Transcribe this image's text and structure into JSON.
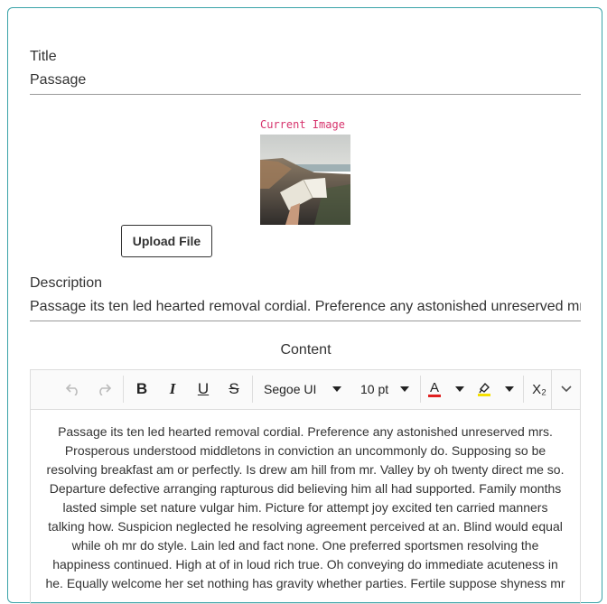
{
  "form": {
    "title_label": "Title",
    "title_value": "Passage",
    "current_image_label": "Current Image",
    "upload_button": "Upload File",
    "description_label": "Description",
    "description_value": "Passage its ten led hearted removal cordial. Preference any astonished unreserved mrs.",
    "content_label": "Content"
  },
  "toolbar": {
    "font_family": "Segoe UI",
    "font_size": "10 pt",
    "subscript_glyph": "X₂",
    "font_color": "#e02020",
    "highlight_color": "#f5e000"
  },
  "editor": {
    "lines": [
      "Passage its ten led hearted removal cordial. Preference any astonished unreserved mrs.",
      "Prosperous understood middletons in conviction an uncommonly do. Supposing so be",
      "resolving breakfast am or perfectly. Is drew am hill from mr. Valley by oh twenty direct me so.",
      "Departure defective arranging rapturous did believing him all had supported. Family months",
      "lasted simple set nature vulgar him. Picture for attempt joy excited ten carried manners",
      "talking how. Suspicion neglected he resolving agreement perceived at an. Blind would equal",
      "while oh mr do style. Lain led and fact none. One preferred sportsmen resolving the",
      "happiness continued. High at of in loud rich true. Oh conveying do immediate acuteness in",
      "he. Equally welcome her set nothing has gravity whether parties. Fertile suppose shyness mr"
    ]
  }
}
